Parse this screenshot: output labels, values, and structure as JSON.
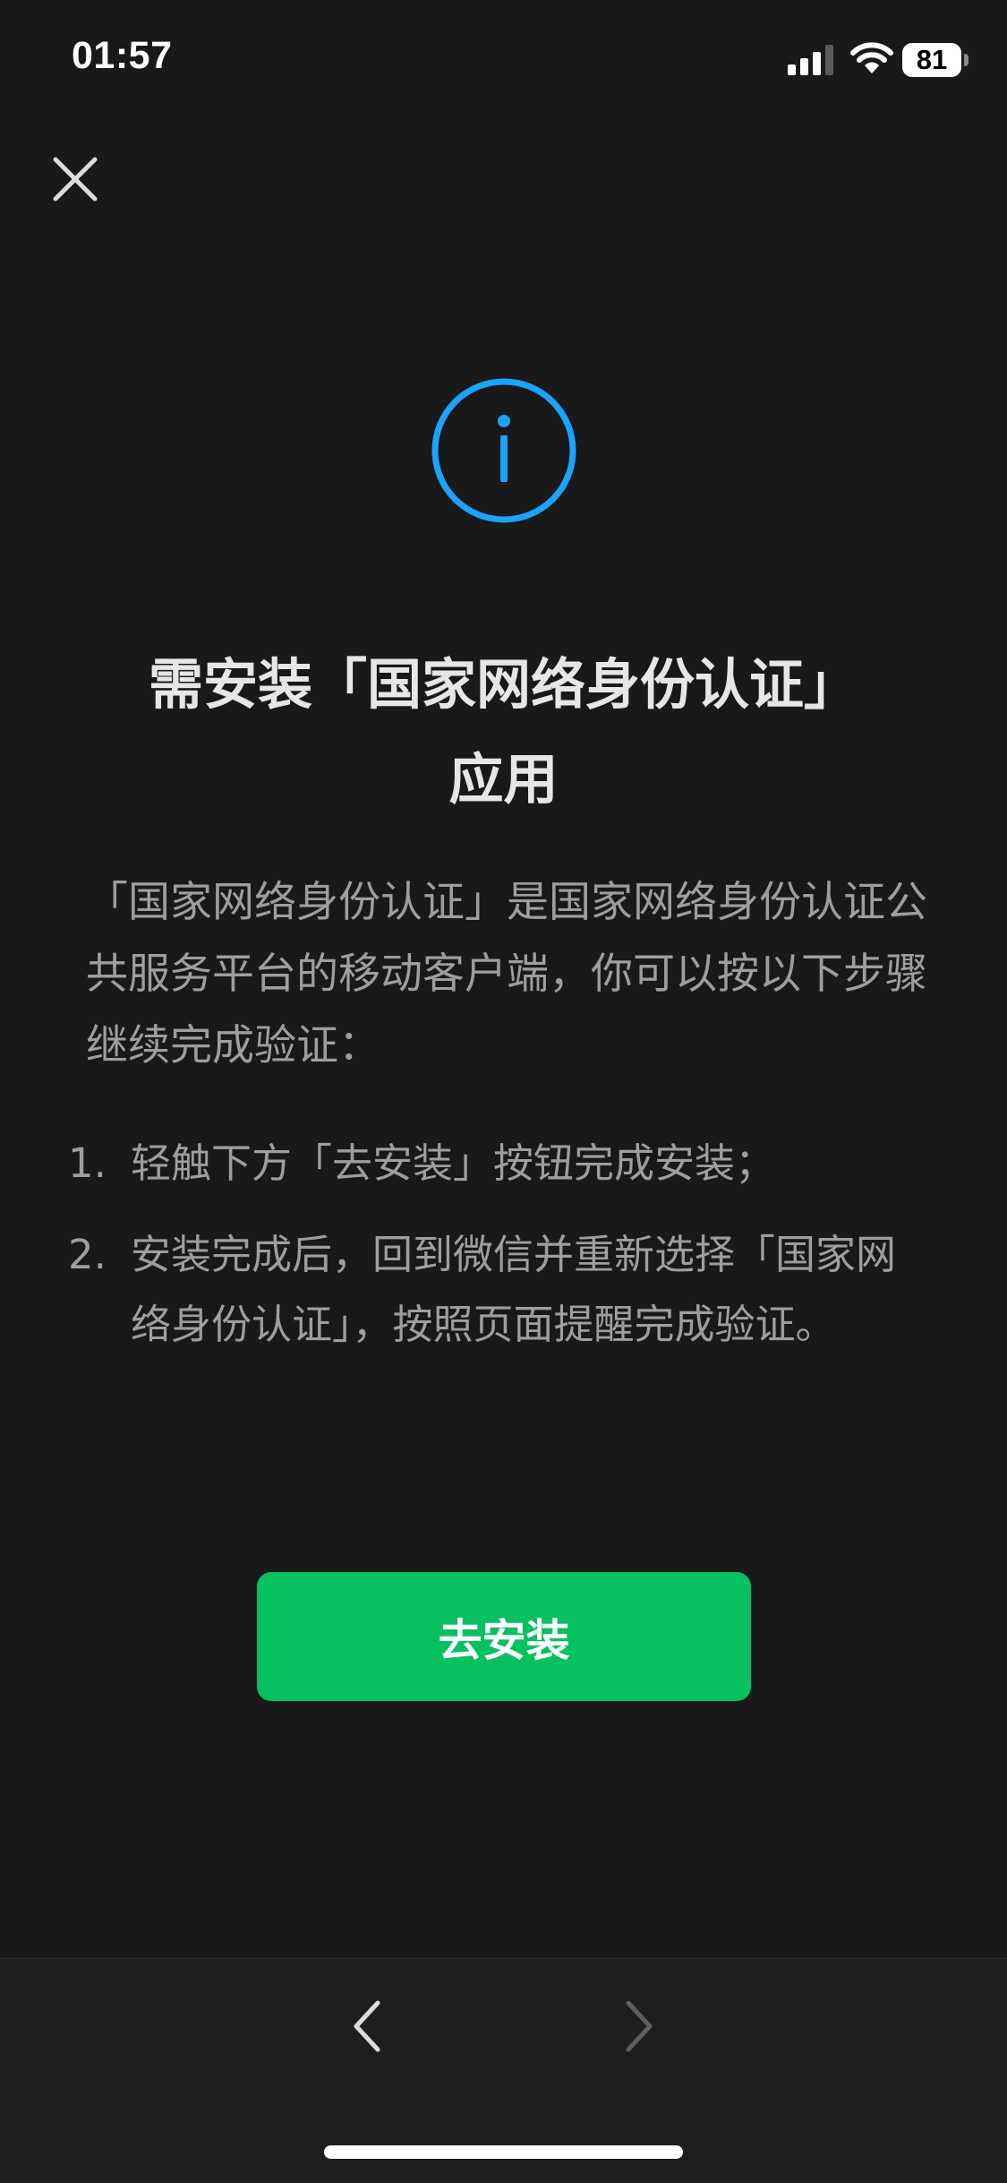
{
  "status_bar": {
    "time": "01:57",
    "battery_level": "81",
    "signal_icon": "cellular-signal-icon",
    "wifi_icon": "wifi-icon"
  },
  "header": {
    "close_icon": "close-icon"
  },
  "info_icon": {
    "name": "info-icon",
    "color": "#1aa3ff"
  },
  "title": {
    "line1": "需安装「国家网络身份认证」",
    "line2": "应用"
  },
  "description": "「国家网络身份认证」是国家网络身份认证公共服务平台的移动客户端，你可以按以下步骤继续完成验证：",
  "steps": [
    {
      "num": "1.",
      "text": "轻触下方「去安装」按钮完成安装；"
    },
    {
      "num": "2.",
      "text": "安装完成后，回到微信并重新选择「国家网络身份认证」，按照页面提醒完成验证。"
    }
  ],
  "install_button": {
    "label": "去安装",
    "color": "#07c160"
  },
  "bottom_toolbar": {
    "back_icon": "chevron-left-icon",
    "forward_icon": "chevron-right-icon"
  }
}
